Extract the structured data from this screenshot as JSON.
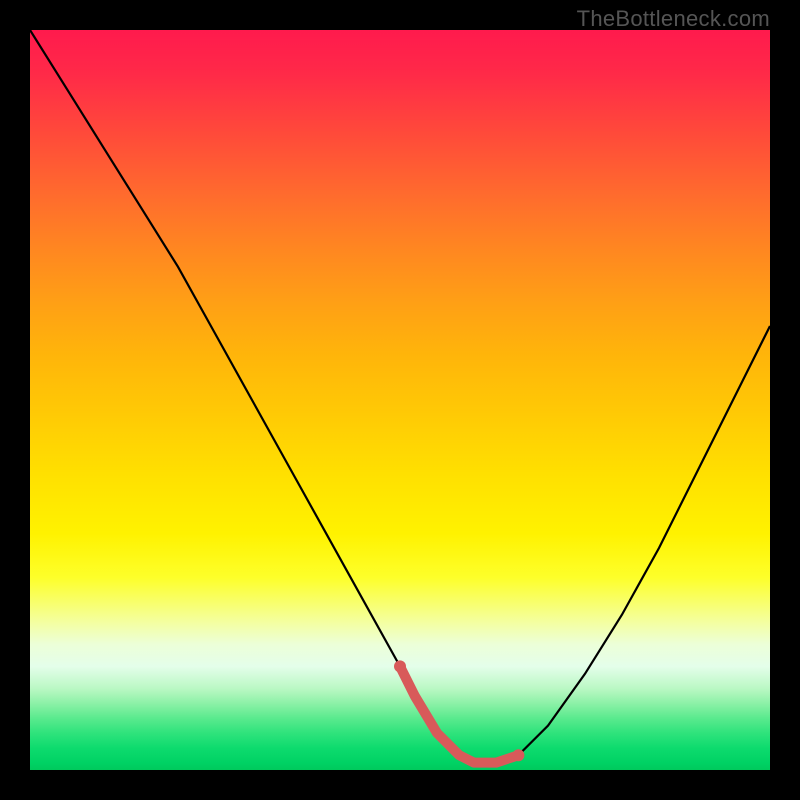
{
  "watermark": "TheBottleneck.com",
  "colors": {
    "frame": "#000000",
    "curve": "#000000",
    "highlight": "#d85a5a",
    "gradient_top": "#ff1a4d",
    "gradient_mid": "#ffe000",
    "gradient_bottom": "#00c95c"
  },
  "chart_data": {
    "type": "line",
    "title": "",
    "xlabel": "",
    "ylabel": "",
    "xlim": [
      0,
      100
    ],
    "ylim": [
      0,
      100
    ],
    "grid": false,
    "legend": false,
    "series": [
      {
        "name": "curve",
        "x": [
          0,
          5,
          10,
          15,
          20,
          25,
          30,
          35,
          40,
          45,
          50,
          52,
          55,
          58,
          60,
          63,
          66,
          70,
          75,
          80,
          85,
          90,
          95,
          100
        ],
        "values": [
          100,
          92,
          84,
          76,
          68,
          59,
          50,
          41,
          32,
          23,
          14,
          10,
          5,
          2,
          1,
          1,
          2,
          6,
          13,
          21,
          30,
          40,
          50,
          60
        ]
      }
    ],
    "highlight_segment": {
      "name": "bottom-flat",
      "x": [
        50,
        52,
        55,
        58,
        60,
        63,
        66
      ],
      "values": [
        14,
        10,
        5,
        2,
        1,
        1,
        2
      ]
    }
  }
}
